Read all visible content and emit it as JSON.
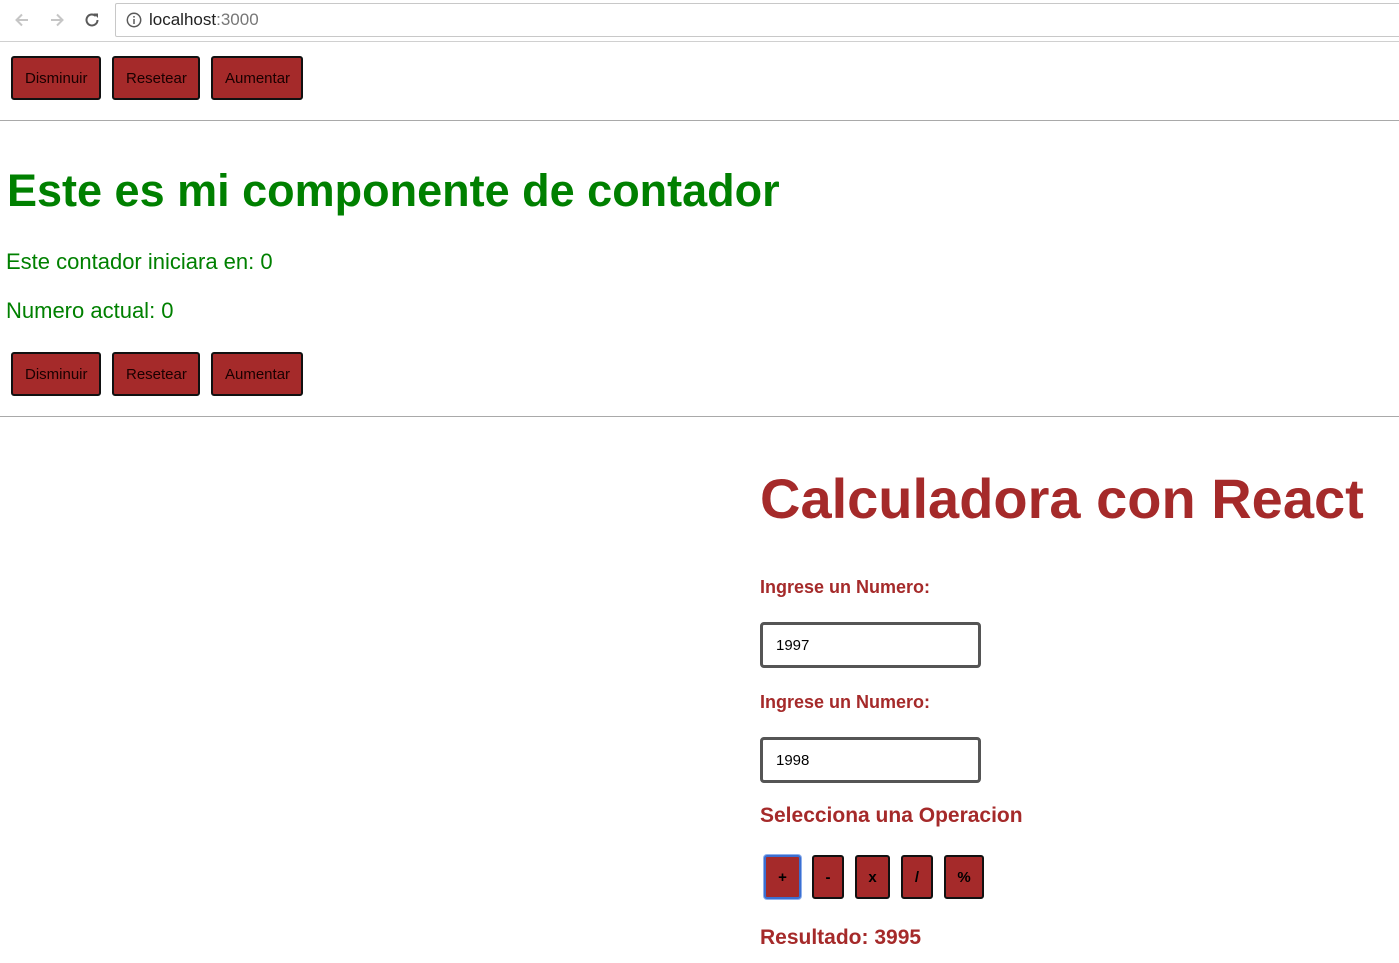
{
  "browser": {
    "url_host": "localhost",
    "url_port": ":3000"
  },
  "top_buttons": {
    "decrease": "Disminuir",
    "reset": "Resetear",
    "increase": "Aumentar"
  },
  "counter": {
    "title": "Este es mi componente de contador",
    "start_text": "Este contador iniciara en: 0",
    "current_text": "Numero actual: 0",
    "decrease": "Disminuir",
    "reset": "Resetear",
    "increase": "Aumentar",
    "color": "#008000"
  },
  "calculator": {
    "title": "Calculadora con React",
    "first_label": "Ingrese un Numero:",
    "first_value": "1997",
    "second_label": "Ingrese un Numero:",
    "second_value": "1998",
    "operation_label": "Selecciona una Operacion",
    "operations": {
      "add": "+",
      "subtract": "-",
      "multiply": "x",
      "divide": "/",
      "modulo": "%"
    },
    "result": "Resultado: 3995",
    "color": "#a52a2a"
  }
}
